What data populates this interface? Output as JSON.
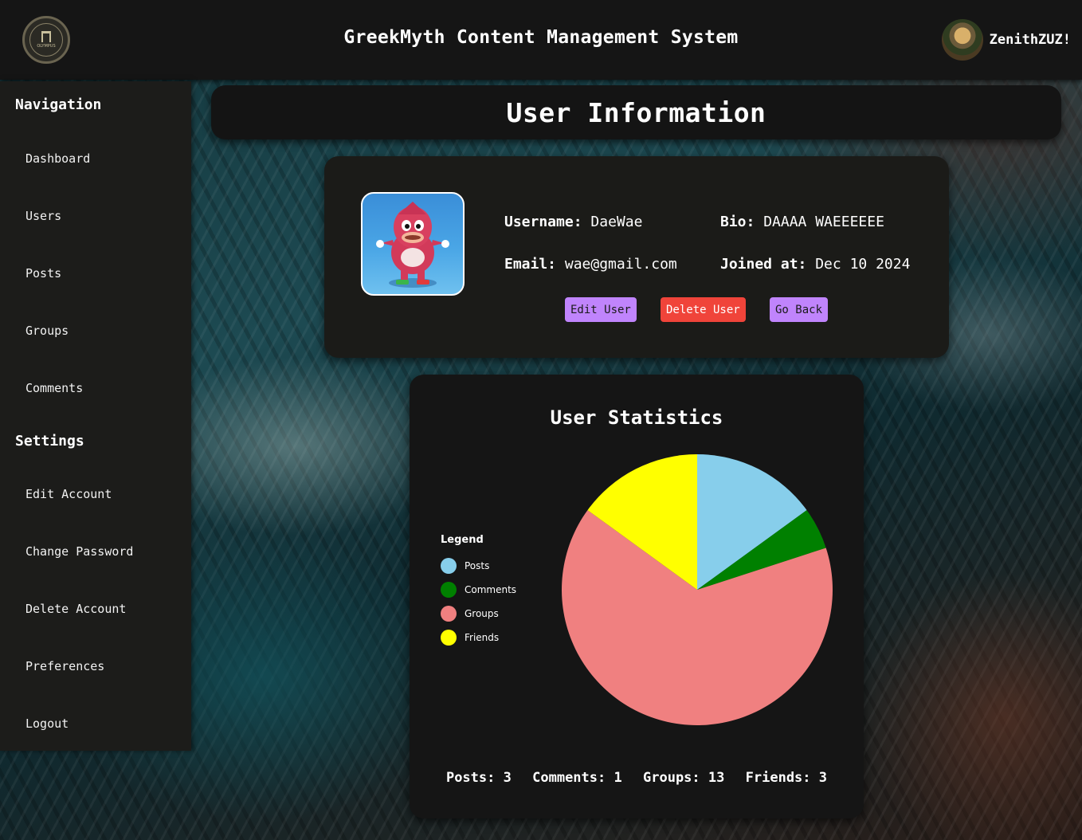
{
  "header": {
    "logo_text": "OLYMPUS",
    "app_title": "GreekMyth Content Management System",
    "user_name": "ZenithZUZ!"
  },
  "sidebar": {
    "nav_heading": "Navigation",
    "nav_items": [
      "Dashboard",
      "Users",
      "Posts",
      "Groups",
      "Comments"
    ],
    "settings_heading": "Settings",
    "settings_items": [
      "Edit Account",
      "Change Password",
      "Delete Account",
      "Preferences",
      "Logout"
    ]
  },
  "page": {
    "title": "User Information"
  },
  "user": {
    "username_label": "Username:",
    "username": "DaeWae",
    "bio_label": "Bio:",
    "bio": "DAAAA WAEEEEEE",
    "email_label": "Email:",
    "email": "wae@gmail.com",
    "joined_label": "Joined at:",
    "joined": "Dec 10 2024"
  },
  "actions": {
    "edit_label": "Edit User",
    "delete_label": "Delete User",
    "back_label": "Go Back",
    "colors": {
      "purple": "#c084fc",
      "red": "#f0443a"
    }
  },
  "stats": {
    "title": "User Statistics",
    "legend_title": "Legend",
    "totals": [
      {
        "label": "Posts:",
        "value": "3"
      },
      {
        "label": "Comments:",
        "value": "1"
      },
      {
        "label": "Groups:",
        "value": "13"
      },
      {
        "label": "Friends:",
        "value": "3"
      }
    ]
  },
  "chart_data": {
    "type": "pie",
    "title": "User Statistics",
    "legend_position": "left",
    "categories": [
      "Posts",
      "Comments",
      "Groups",
      "Friends"
    ],
    "values": [
      3,
      1,
      13,
      3
    ],
    "colors": [
      "#87ceeb",
      "#008000",
      "#f08080",
      "#ffff00"
    ]
  }
}
